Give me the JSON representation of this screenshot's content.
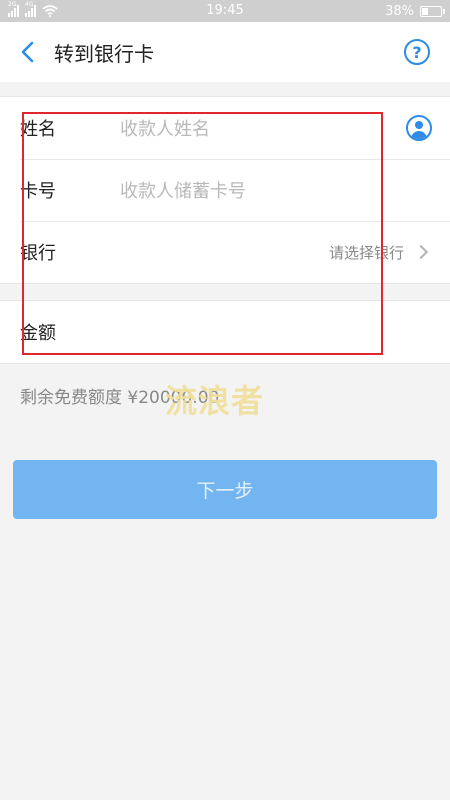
{
  "status_bar": {
    "network_left": "2G",
    "network_right": "4G",
    "time": "19:45",
    "battery": "38%",
    "battery_level": 0.38
  },
  "navbar": {
    "title": "转到银行卡",
    "help_symbol": "?",
    "back_icon": "back-chevron-icon",
    "help_icon": "help-circle-icon"
  },
  "form": {
    "name": {
      "label": "姓名",
      "placeholder": "收款人姓名",
      "icon": "contact-person-icon"
    },
    "card": {
      "label": "卡号",
      "placeholder": "收款人储蓄卡号"
    },
    "bank": {
      "label": "银行",
      "hint": "请选择银行"
    },
    "amount": {
      "label": "金额"
    }
  },
  "quota": {
    "text": "剩余免费额度 ¥20000.00"
  },
  "watermark": "流浪者",
  "next_button": {
    "label": "下一步"
  },
  "colors": {
    "accent": "#2e8be6",
    "button": "#72b5f0",
    "highlight": "#e0262e"
  }
}
